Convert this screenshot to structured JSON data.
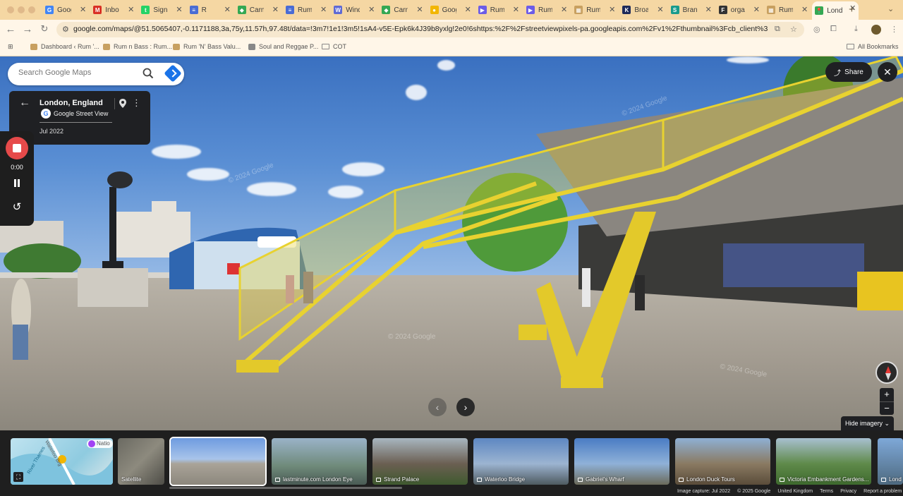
{
  "browser": {
    "tabs": [
      {
        "label": "Goog",
        "color": "#4285f4",
        "glyph": "G"
      },
      {
        "label": "Inbo",
        "color": "#d93025",
        "glyph": "M"
      },
      {
        "label": "Sign",
        "color": "#25d366",
        "glyph": "t"
      },
      {
        "label": "R",
        "color": "#4a6cd4",
        "glyph": "≡"
      },
      {
        "label": "Carn",
        "color": "#34a853",
        "glyph": "◆"
      },
      {
        "label": "Rum",
        "color": "#4a6cd4",
        "glyph": "≡"
      },
      {
        "label": "Wind",
        "color": "#5f6ad4",
        "glyph": "W"
      },
      {
        "label": "Carn",
        "color": "#34a853",
        "glyph": "◆"
      },
      {
        "label": "Goog",
        "color": "#f2b600",
        "glyph": "●"
      },
      {
        "label": "Rum",
        "color": "#6c5ce7",
        "glyph": "▶"
      },
      {
        "label": "Rum",
        "color": "#6c5ce7",
        "glyph": "▶"
      },
      {
        "label": "Rum",
        "color": "#c8a060",
        "glyph": "▦"
      },
      {
        "label": "Broa",
        "color": "#1e2a5a",
        "glyph": "K"
      },
      {
        "label": "Bran",
        "color": "#1a9b8c",
        "glyph": "S"
      },
      {
        "label": "orga",
        "color": "#333333",
        "glyph": "F"
      },
      {
        "label": "Rum",
        "color": "#c8a060",
        "glyph": "▦"
      },
      {
        "label": "Lond",
        "color": "#34a853",
        "glyph": "📍",
        "active": true
      }
    ],
    "url": "google.com/maps/@51.5065407,-0.1171188,3a,75y,11.57h,97.48t/data=!3m7!1e1!3m5!1sA4-v5E-Epk6k4J39b8yxlg!2e0!6shttps:%2F%2Fstreetviewpixels-pa.googleapis.com%2Fv1%2Fthumbnail%3Fcb_client%3Dmaps_sv...",
    "bookmarks": [
      {
        "label": "Dashboard ‹ Rum '...",
        "color": "#c8a060"
      },
      {
        "label": "Rum n Bass : Rum...",
        "color": "#c8a060"
      },
      {
        "label": "Rum 'N' Bass Valu...",
        "color": "#c8a060"
      },
      {
        "label": "Soul and Reggae P...",
        "color": "#888888"
      },
      {
        "label": "COT",
        "folder": true
      }
    ],
    "all_bookmarks_label": "All Bookmarks"
  },
  "maps": {
    "search_placeholder": "Search Google Maps",
    "location_title": "London, England",
    "source_label": "Google Street View",
    "capture_date": "Jul 2022",
    "recorder_time": "0:00",
    "share_label": "Share",
    "hide_imagery_label": "Hide imagery",
    "watermark": "© 2024 Google"
  },
  "filmstrip": {
    "thumbnails": [
      {
        "label": "",
        "kind": "map",
        "bg": "linear-gradient(135deg,#bfe3f0,#8fcbe0 60%,#dfe9ea)"
      },
      {
        "label": "Satellite",
        "kind": "satellite",
        "bg": "linear-gradient(135deg,#6b6a62,#8d8a7e 50%,#4d4c46)"
      },
      {
        "label": "",
        "kind": "current",
        "bg": "linear-gradient(180deg,#6e9be0 0%,#a8c4ea 45%,#a9a398 55%,#8c877d 100%)"
      },
      {
        "label": "lastminute.com London Eye",
        "kind": "photo",
        "bg": "linear-gradient(180deg,#9ab3c8,#6f8a7a 60%,#4a5b55)"
      },
      {
        "label": "Strand Palace",
        "kind": "photo",
        "bg": "linear-gradient(180deg,#a8b6c0,#6b5f52 55%,#3f5a2f)"
      },
      {
        "label": "Waterloo Bridge",
        "kind": "photo",
        "bg": "linear-gradient(180deg,#5d87c2,#9cb4d1 55%,#4e5a60)"
      },
      {
        "label": "Gabriel's Wharf",
        "kind": "photo",
        "bg": "linear-gradient(180deg,#4a7cc4,#8fb1d8 55%,#6b6a5a)"
      },
      {
        "label": "London Duck Tours",
        "kind": "photo",
        "bg": "linear-gradient(180deg,#8eb0d4,#8a7a62 55%,#5a4c3a)"
      },
      {
        "label": "Victoria Embankment Gardens...",
        "kind": "photo",
        "bg": "linear-gradient(180deg,#a8c0d0,#5f8a4a 55%,#3e6a2e)"
      },
      {
        "label": "Lond",
        "kind": "photo",
        "bg": "linear-gradient(180deg,#7ea8d8,#4e6a80)"
      }
    ],
    "footer": [
      "Image capture: Jul 2022",
      "© 2025 Google",
      "United Kingdom",
      "Terms",
      "Privacy",
      "Report a problem"
    ]
  },
  "map_thumb_labels": {
    "road1": "River Thames",
    "road2": "Waterloo Brg",
    "badge": "Natio"
  }
}
